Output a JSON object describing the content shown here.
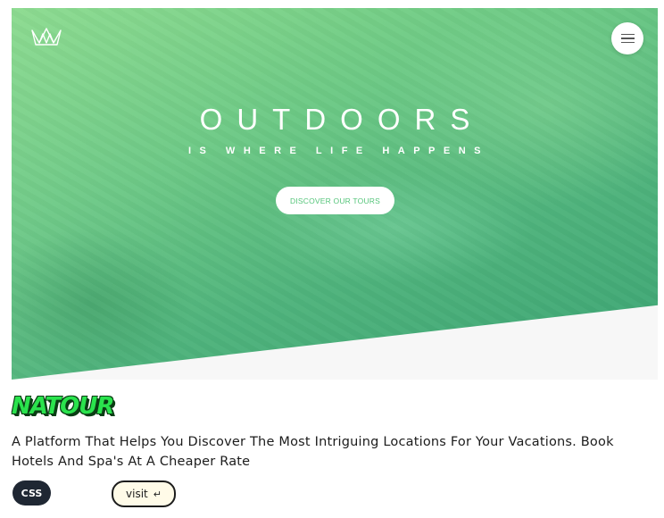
{
  "preview": {
    "hero": {
      "title": "OUTDOORS",
      "subtitle": "IS WHERE LIFE HAPPENS",
      "cta_label": "DISCOVER OUR TOURS"
    },
    "logo_icon": "crown-logo-icon",
    "menu_icon": "hamburger-menu-icon"
  },
  "project": {
    "name": "NATOUR",
    "description": "A Platform That Helps You Discover The Most Intriguing Locations For Your Vacations. Book Hotels And Spa's At A Cheaper Rate",
    "tag": "CSS",
    "visit_label": "visit",
    "visit_icon": "↵"
  },
  "colors": {
    "accent_green": "#55c57a",
    "brand_green": "#2ae34d",
    "tag_bg": "#1f2733"
  }
}
